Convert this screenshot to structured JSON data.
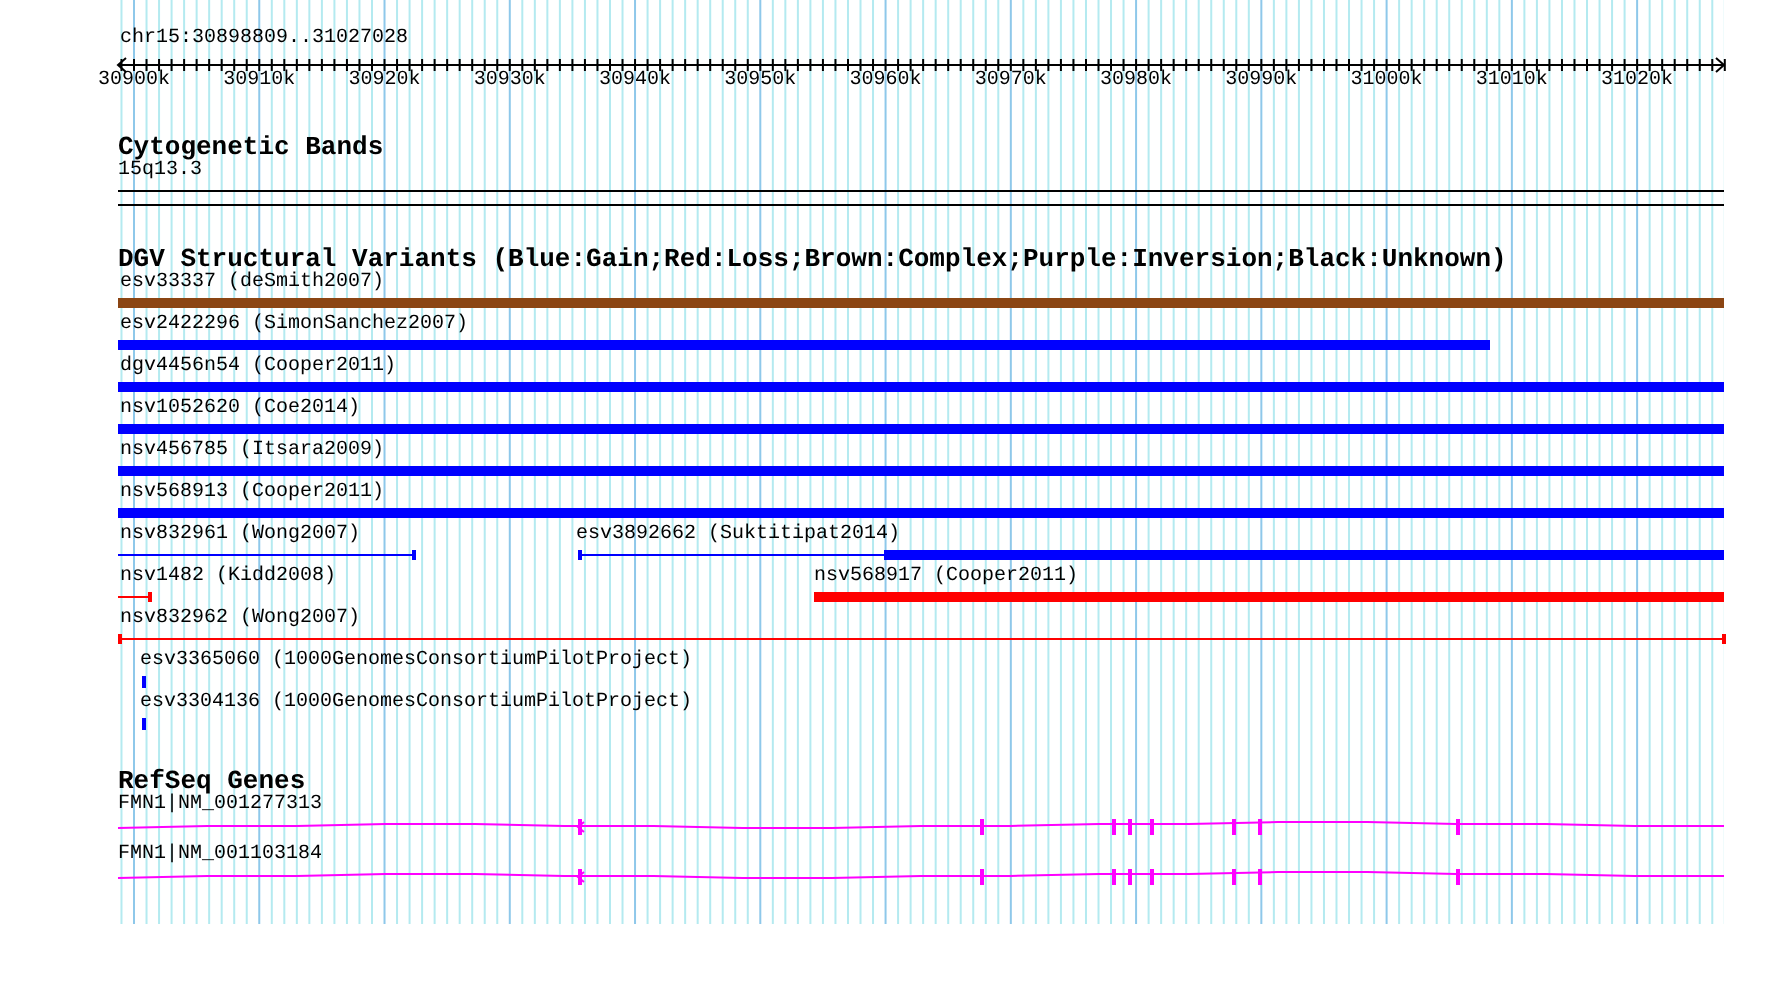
{
  "ruler": {
    "position": "chr15:30898809..31027028",
    "ticks": [
      "30900k",
      "30910k",
      "30920k",
      "30930k",
      "30940k",
      "30950k",
      "30960k",
      "30970k",
      "30980k",
      "30990k",
      "31000k",
      "31010k",
      "31020k"
    ]
  },
  "cytogenetic_bands": {
    "title": "Cytogenetic Bands",
    "bands": [
      {
        "label": "15q13.3"
      }
    ]
  },
  "dgv": {
    "title": "DGV Structural Variants (Blue:Gain;Red:Loss;Brown:Complex;Purple:Inversion;Black:Unknown)",
    "rows": [
      {
        "features": [
          {
            "label": "esv33337 (deSmith2007)",
            "color": "#8b4513"
          }
        ]
      },
      {
        "features": [
          {
            "label": "esv2422296 (SimonSanchez2007)",
            "color": "#0000ff"
          }
        ]
      },
      {
        "features": [
          {
            "label": "dgv4456n54 (Cooper2011)",
            "color": "#0000ff"
          }
        ]
      },
      {
        "features": [
          {
            "label": "nsv1052620 (Coe2014)",
            "color": "#0000ff"
          }
        ]
      },
      {
        "features": [
          {
            "label": "nsv456785 (Itsara2009)",
            "color": "#0000ff"
          }
        ]
      },
      {
        "features": [
          {
            "label": "nsv568913 (Cooper2011)",
            "color": "#0000ff"
          }
        ]
      },
      {
        "features": [
          {
            "label": "nsv832961 (Wong2007)",
            "color": "#0000ff"
          },
          {
            "label": "esv3892662 (Suktitipat2014)",
            "color": "#0000ff"
          }
        ]
      },
      {
        "features": [
          {
            "label": "nsv1482 (Kidd2008)",
            "color": "#ff0000"
          },
          {
            "label": "nsv568917 (Cooper2011)",
            "color": "#ff0000"
          }
        ]
      },
      {
        "features": [
          {
            "label": "nsv832962 (Wong2007)",
            "color": "#ff0000"
          }
        ]
      },
      {
        "features": [
          {
            "label": "esv3365060 (1000GenomesConsortiumPilotProject)",
            "color": "#0000ff"
          }
        ]
      },
      {
        "features": [
          {
            "label": "esv3304136 (1000GenomesConsortiumPilotProject)",
            "color": "#0000ff"
          }
        ]
      }
    ]
  },
  "refseq": {
    "title": "RefSeq Genes",
    "genes": [
      {
        "label": "FMN1|NM_001277313"
      },
      {
        "label": "FMN1|NM_001103184"
      }
    ]
  }
}
